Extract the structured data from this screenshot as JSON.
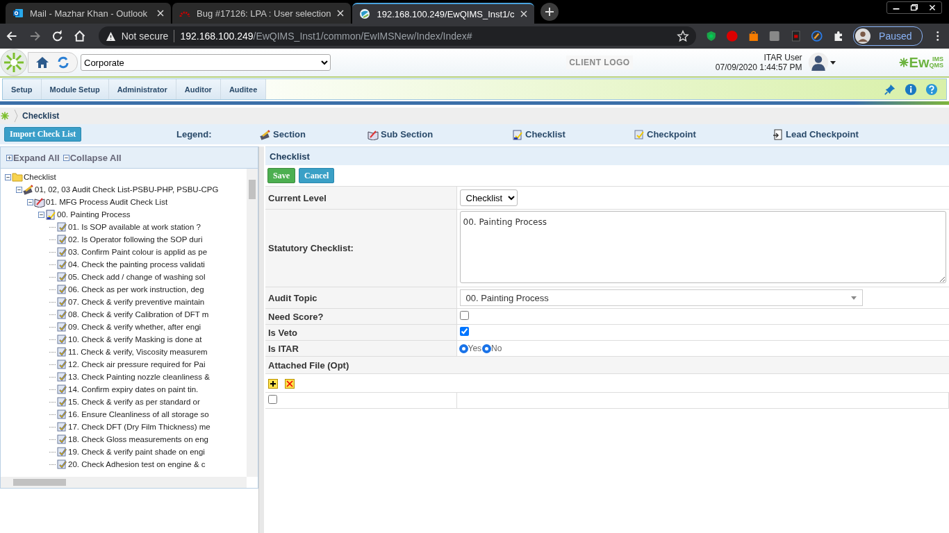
{
  "browser": {
    "tabs": [
      {
        "title": "Mail - Mazhar Khan - Outlook",
        "kind": "mail",
        "selected": false
      },
      {
        "title": "Bug #17126: LPA : User selection",
        "kind": "bug",
        "selected": false
      },
      {
        "title": "192.168.100.249/EwQIMS_Inst1/c",
        "kind": "app",
        "selected": true
      }
    ],
    "security": "Not secure",
    "host": "192.168.100.249",
    "path": "/EwQIMS_Inst1/common/EwIMSNew/Index/Index#",
    "profile": "Paused"
  },
  "header": {
    "unit": "Corporate",
    "client_logo": "CLIENT LOGO",
    "user": "ITAR User",
    "datetime": "07/09/2020 1:44:57 PM",
    "brand": {
      "main": "Ew",
      "top": "IMS",
      "bottom": "QMS"
    }
  },
  "menu": [
    "Setup",
    "Module Setup",
    "Administrator",
    "Auditor",
    "Auditee"
  ],
  "breadcrumb": "Checklist",
  "import_button": "Import Check List",
  "legend_label": "Legend:",
  "legend": [
    {
      "label": "Section",
      "kind": "section"
    },
    {
      "label": "Sub Section",
      "kind": "subsection"
    },
    {
      "label": "Checklist",
      "kind": "checklist"
    },
    {
      "label": "Checkpoint",
      "kind": "checkpoint"
    },
    {
      "label": "Lead Checkpoint",
      "kind": "lead"
    }
  ],
  "tree": {
    "expand_all": "Expand All",
    "collapse_all": "Collapse All",
    "nodes": [
      {
        "label": "Checklist",
        "kind": "folder",
        "expanded": true,
        "children": [
          {
            "label": "01, 02, 03 Audit Check List-PSBU-PHP, PSBU-CPG",
            "kind": "section",
            "expanded": true,
            "children": [
              {
                "label": "01. MFG Process Audit Check List",
                "kind": "subsection",
                "expanded": true,
                "children": [
                  {
                    "label": "00. Painting Process",
                    "kind": "checklist",
                    "expanded": true,
                    "children": [
                      {
                        "label": "01. Is SOP available at work station ?",
                        "kind": "checkpoint"
                      },
                      {
                        "label": "02. Is Operator following the SOP duri",
                        "kind": "checkpoint"
                      },
                      {
                        "label": "03. Confirm Paint colour is applid as pe",
                        "kind": "checkpoint"
                      },
                      {
                        "label": "04. Check the painting process validati",
                        "kind": "checkpoint"
                      },
                      {
                        "label": "05. Check add / change of washing sol",
                        "kind": "checkpoint"
                      },
                      {
                        "label": "06. Check as per work instruction, deg",
                        "kind": "checkpoint"
                      },
                      {
                        "label": "07. Check & verify preventive maintain",
                        "kind": "checkpoint"
                      },
                      {
                        "label": "08. Check & verify Calibration of DFT m",
                        "kind": "checkpoint"
                      },
                      {
                        "label": "09. Check & verify whether, after engi",
                        "kind": "checkpoint"
                      },
                      {
                        "label": "10. Check & verify Masking is done at",
                        "kind": "checkpoint"
                      },
                      {
                        "label": "11. Check & verify, Viscosity measurem",
                        "kind": "checkpoint"
                      },
                      {
                        "label": "12. Check air pressure required for Pai",
                        "kind": "checkpoint"
                      },
                      {
                        "label": "13. Check Painting nozzle cleanliness &",
                        "kind": "checkpoint"
                      },
                      {
                        "label": "14. Confirm expiry dates on paint tin.",
                        "kind": "checkpoint"
                      },
                      {
                        "label": "15. Check & verify as per standard or",
                        "kind": "checkpoint"
                      },
                      {
                        "label": "16. Ensure Cleanliness of all storage so",
                        "kind": "checkpoint"
                      },
                      {
                        "label": "17. Check DFT (Dry Film Thickness) me",
                        "kind": "checkpoint"
                      },
                      {
                        "label": "18. Check Gloss measurements on eng",
                        "kind": "checkpoint"
                      },
                      {
                        "label": "19. Check & verify paint shade on engi",
                        "kind": "checkpoint"
                      },
                      {
                        "label": "20. Check Adhesion test on engine & c",
                        "kind": "checkpoint"
                      }
                    ]
                  }
                ]
              }
            ]
          }
        ]
      }
    ]
  },
  "form": {
    "title": "Checklist",
    "buttons": [
      {
        "label": "Save",
        "kind": "save"
      },
      {
        "label": "Cancel",
        "kind": "cancel"
      }
    ],
    "fields": [
      {
        "kind": "select",
        "label": "Current Level",
        "value": "Checklist"
      },
      {
        "kind": "textarea",
        "label": "Statutory Checklist:",
        "value": "00. Painting Process"
      },
      {
        "kind": "combo",
        "label": "Audit Topic",
        "value": "00. Painting Process"
      },
      {
        "kind": "checkbox",
        "label": "Need Score?",
        "checked": false
      },
      {
        "kind": "checkbox",
        "label": "Is Veto",
        "checked": true
      },
      {
        "kind": "radio",
        "label": "Is ITAR",
        "options": [
          {
            "label": "Yes",
            "selected": true
          },
          {
            "label": "No",
            "selected": true
          }
        ]
      }
    ],
    "attachments": {
      "title": "Attached File (Opt)",
      "rows": [
        {
          "checked": false
        }
      ]
    }
  }
}
